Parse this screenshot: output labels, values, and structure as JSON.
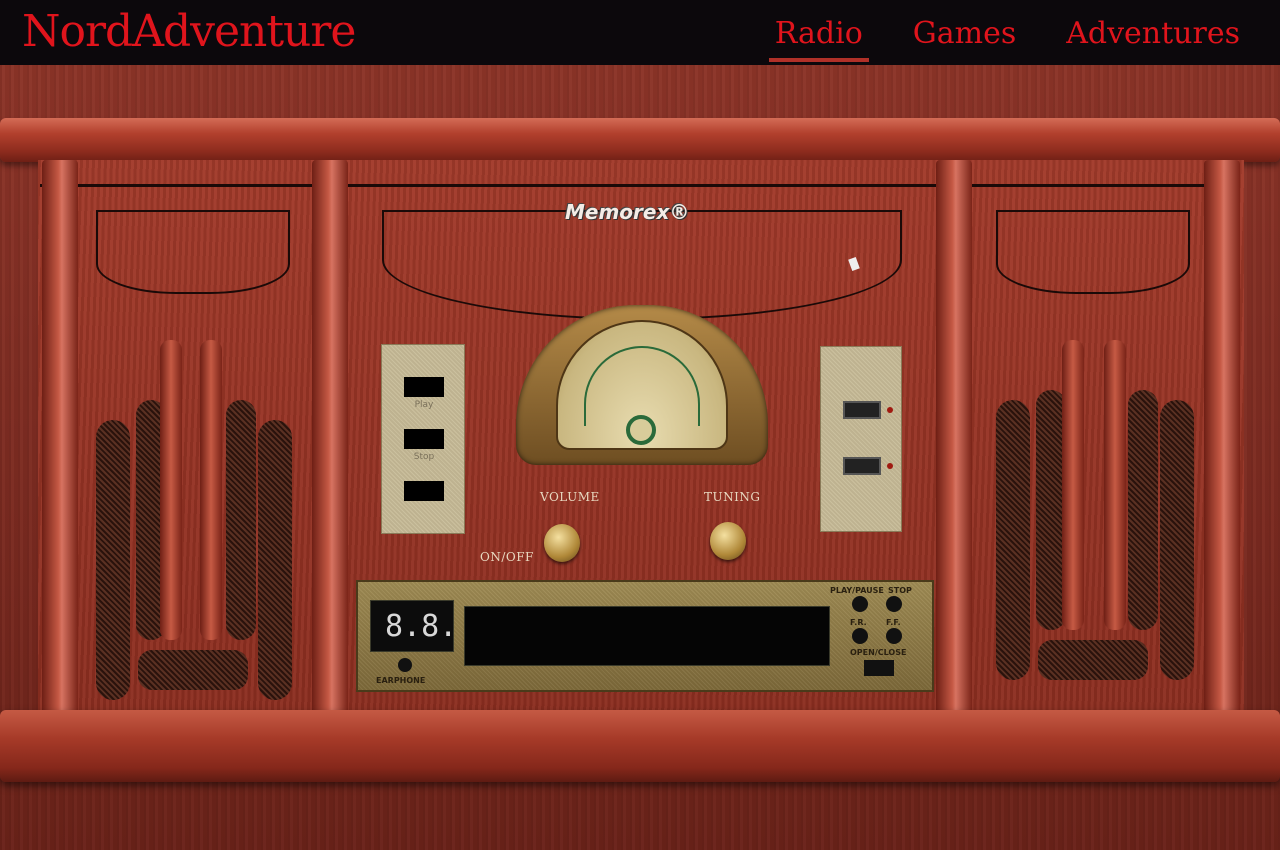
{
  "site": {
    "brand": "NordAdventure"
  },
  "nav": {
    "items": [
      {
        "label": "Radio",
        "active": true
      },
      {
        "label": "Games",
        "active": false
      },
      {
        "label": "Adventures",
        "active": false
      }
    ]
  },
  "radio": {
    "logo": "Memorex®",
    "knobs": {
      "volume_label": "VOLUME",
      "tuning_label": "TUNING",
      "power_label": "ON/OFF"
    },
    "controls": {
      "play_label": "Play",
      "stop_label": "Stop"
    },
    "cd": {
      "display": "8.8.",
      "earphone_label": "EARPHONE",
      "play_pause_label": "PLAY/PAUSE",
      "stop_label": "STOP",
      "fr_label": "F.R.",
      "ff_label": "F.F.",
      "open_close_label": "OPEN/CLOSE"
    }
  },
  "colors": {
    "accent": "#e0141c",
    "topbar": "#0c080c"
  }
}
